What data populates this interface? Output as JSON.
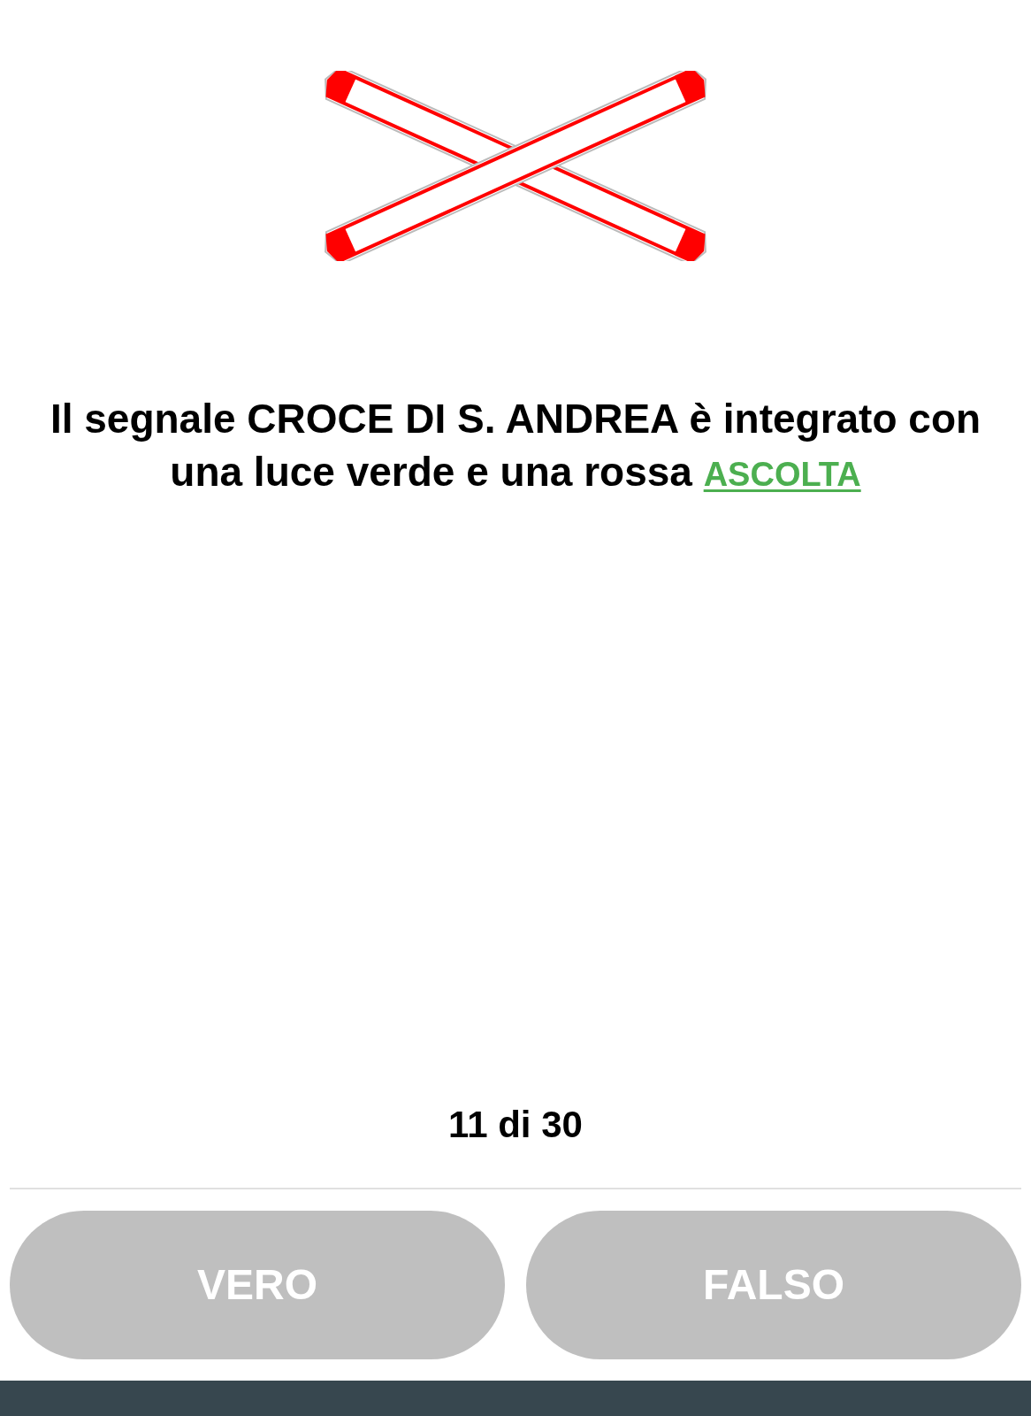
{
  "question": {
    "text": "Il segnale CROCE DI S. ANDREA è integrato con una luce verde e una rossa",
    "listen_link": "ASCOLTA"
  },
  "progress": "11 di 30",
  "answers": [
    "VERO",
    "FALSO"
  ]
}
